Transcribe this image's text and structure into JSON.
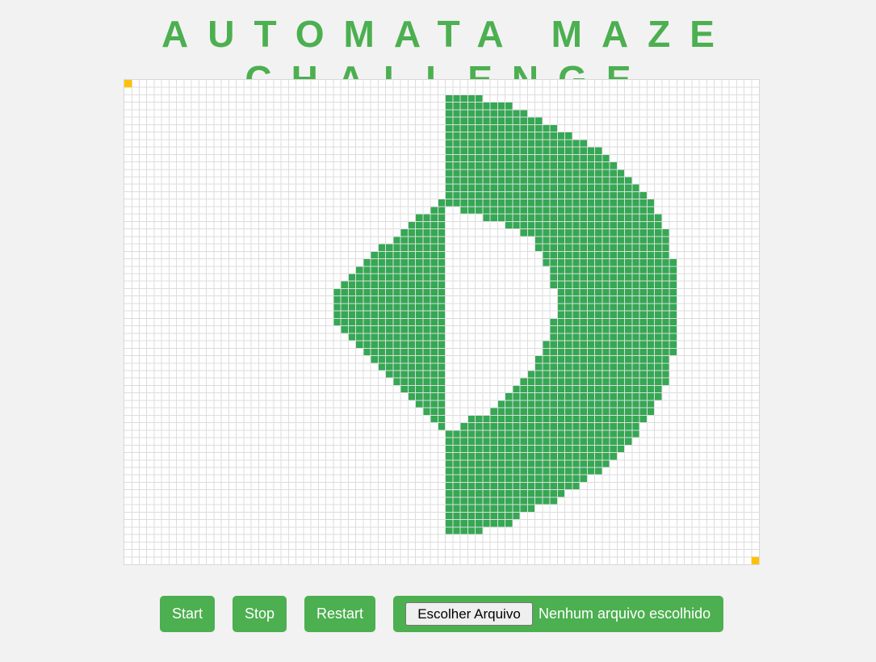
{
  "page": {
    "title": "AUTOMATA MAZE CHALLENGE"
  },
  "maze": {
    "columns": 85,
    "rows": 65,
    "colors": {
      "background": "#ffffff",
      "grid_line": "#dddddd",
      "wall": "#34a853",
      "endpoint": "#ffc107"
    },
    "start_cell": [
      0,
      0
    ],
    "goal_cell": [
      84,
      64
    ],
    "wall_rows": [
      {
        "row": 2,
        "spans": [
          [
            43,
            47
          ]
        ]
      },
      {
        "row": 3,
        "spans": [
          [
            43,
            51
          ]
        ]
      },
      {
        "row": 4,
        "spans": [
          [
            43,
            53
          ]
        ]
      },
      {
        "row": 5,
        "spans": [
          [
            43,
            55
          ]
        ]
      },
      {
        "row": 6,
        "spans": [
          [
            43,
            57
          ]
        ]
      },
      {
        "row": 7,
        "spans": [
          [
            43,
            59
          ]
        ]
      },
      {
        "row": 8,
        "spans": [
          [
            43,
            61
          ]
        ]
      },
      {
        "row": 9,
        "spans": [
          [
            43,
            63
          ]
        ]
      },
      {
        "row": 10,
        "spans": [
          [
            43,
            64
          ]
        ]
      },
      {
        "row": 11,
        "spans": [
          [
            43,
            65
          ]
        ]
      },
      {
        "row": 12,
        "spans": [
          [
            43,
            66
          ]
        ]
      },
      {
        "row": 13,
        "spans": [
          [
            43,
            67
          ]
        ]
      },
      {
        "row": 14,
        "spans": [
          [
            43,
            68
          ]
        ]
      },
      {
        "row": 15,
        "spans": [
          [
            43,
            69
          ]
        ]
      },
      {
        "row": 16,
        "spans": [
          [
            42,
            42
          ],
          [
            43,
            70
          ]
        ]
      },
      {
        "row": 17,
        "spans": [
          [
            41,
            42
          ],
          [
            45,
            70
          ]
        ]
      },
      {
        "row": 18,
        "spans": [
          [
            39,
            42
          ],
          [
            48,
            71
          ]
        ]
      },
      {
        "row": 19,
        "spans": [
          [
            38,
            42
          ],
          [
            51,
            71
          ]
        ]
      },
      {
        "row": 20,
        "spans": [
          [
            37,
            42
          ],
          [
            53,
            72
          ]
        ]
      },
      {
        "row": 21,
        "spans": [
          [
            36,
            42
          ],
          [
            55,
            72
          ]
        ]
      },
      {
        "row": 22,
        "spans": [
          [
            34,
            42
          ],
          [
            55,
            72
          ]
        ]
      },
      {
        "row": 23,
        "spans": [
          [
            33,
            42
          ],
          [
            56,
            72
          ]
        ]
      },
      {
        "row": 24,
        "spans": [
          [
            32,
            42
          ],
          [
            56,
            73
          ]
        ]
      },
      {
        "row": 25,
        "spans": [
          [
            31,
            42
          ],
          [
            57,
            73
          ]
        ]
      },
      {
        "row": 26,
        "spans": [
          [
            30,
            42
          ],
          [
            57,
            73
          ]
        ]
      },
      {
        "row": 27,
        "spans": [
          [
            29,
            42
          ],
          [
            57,
            73
          ]
        ]
      },
      {
        "row": 28,
        "spans": [
          [
            28,
            42
          ],
          [
            58,
            73
          ]
        ]
      },
      {
        "row": 29,
        "spans": [
          [
            28,
            42
          ],
          [
            58,
            73
          ]
        ]
      },
      {
        "row": 30,
        "spans": [
          [
            28,
            42
          ],
          [
            58,
            73
          ]
        ]
      },
      {
        "row": 31,
        "spans": [
          [
            28,
            42
          ],
          [
            58,
            73
          ]
        ]
      },
      {
        "row": 32,
        "spans": [
          [
            28,
            42
          ],
          [
            57,
            73
          ]
        ]
      },
      {
        "row": 33,
        "spans": [
          [
            29,
            42
          ],
          [
            57,
            73
          ]
        ]
      },
      {
        "row": 34,
        "spans": [
          [
            30,
            42
          ],
          [
            57,
            73
          ]
        ]
      },
      {
        "row": 35,
        "spans": [
          [
            31,
            42
          ],
          [
            56,
            73
          ]
        ]
      },
      {
        "row": 36,
        "spans": [
          [
            32,
            42
          ],
          [
            56,
            73
          ]
        ]
      },
      {
        "row": 37,
        "spans": [
          [
            33,
            42
          ],
          [
            55,
            72
          ]
        ]
      },
      {
        "row": 38,
        "spans": [
          [
            34,
            42
          ],
          [
            55,
            72
          ]
        ]
      },
      {
        "row": 39,
        "spans": [
          [
            35,
            42
          ],
          [
            54,
            72
          ]
        ]
      },
      {
        "row": 40,
        "spans": [
          [
            36,
            42
          ],
          [
            53,
            72
          ]
        ]
      },
      {
        "row": 41,
        "spans": [
          [
            37,
            42
          ],
          [
            52,
            71
          ]
        ]
      },
      {
        "row": 42,
        "spans": [
          [
            38,
            42
          ],
          [
            51,
            71
          ]
        ]
      },
      {
        "row": 43,
        "spans": [
          [
            39,
            42
          ],
          [
            50,
            70
          ]
        ]
      },
      {
        "row": 44,
        "spans": [
          [
            40,
            42
          ],
          [
            49,
            70
          ]
        ]
      },
      {
        "row": 45,
        "spans": [
          [
            41,
            42
          ],
          [
            46,
            69
          ]
        ]
      },
      {
        "row": 46,
        "spans": [
          [
            42,
            42
          ],
          [
            45,
            68
          ]
        ]
      },
      {
        "row": 47,
        "spans": [
          [
            43,
            68
          ]
        ]
      },
      {
        "row": 48,
        "spans": [
          [
            43,
            67
          ]
        ]
      },
      {
        "row": 49,
        "spans": [
          [
            43,
            66
          ]
        ]
      },
      {
        "row": 50,
        "spans": [
          [
            43,
            65
          ]
        ]
      },
      {
        "row": 51,
        "spans": [
          [
            43,
            64
          ]
        ]
      },
      {
        "row": 52,
        "spans": [
          [
            43,
            63
          ]
        ]
      },
      {
        "row": 53,
        "spans": [
          [
            43,
            61
          ]
        ]
      },
      {
        "row": 54,
        "spans": [
          [
            43,
            60
          ]
        ]
      },
      {
        "row": 55,
        "spans": [
          [
            43,
            58
          ]
        ]
      },
      {
        "row": 56,
        "spans": [
          [
            43,
            57
          ]
        ]
      },
      {
        "row": 57,
        "spans": [
          [
            43,
            54
          ]
        ]
      },
      {
        "row": 58,
        "spans": [
          [
            43,
            52
          ]
        ]
      },
      {
        "row": 59,
        "spans": [
          [
            43,
            51
          ]
        ]
      },
      {
        "row": 60,
        "spans": [
          [
            43,
            47
          ]
        ]
      }
    ]
  },
  "controls": {
    "start_label": "Start",
    "stop_label": "Stop",
    "restart_label": "Restart",
    "file_button_label": "Escolher Arquivo",
    "file_status": "Nenhum arquivo escolhido"
  }
}
